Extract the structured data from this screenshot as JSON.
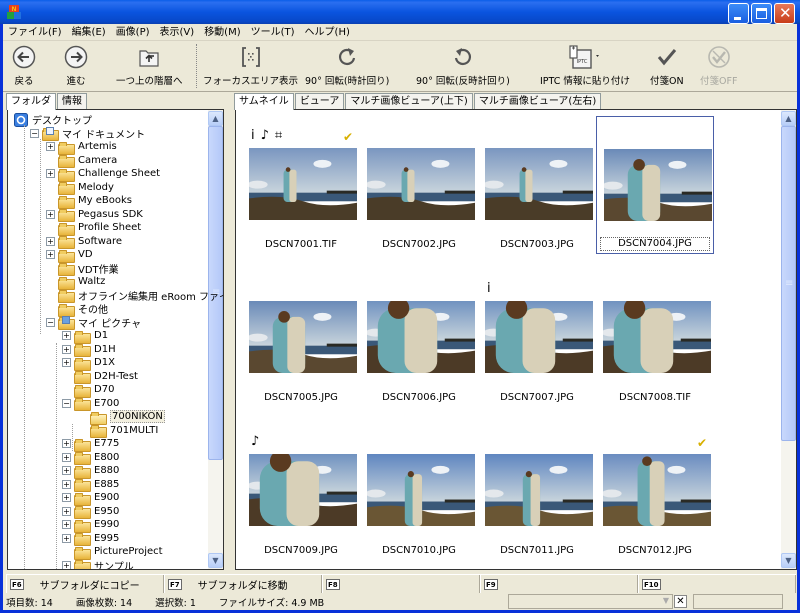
{
  "window": {
    "title": ""
  },
  "menu": [
    "ファイル(F)",
    "編集(E)",
    "画像(P)",
    "表示(V)",
    "移動(M)",
    "ツール(T)",
    "ヘルプ(H)"
  ],
  "toolbar": {
    "back": "戻る",
    "forward": "進む",
    "up": "一つ上の階層へ",
    "focus_area": "フォーカスエリア表示",
    "rotate_cw": "90° 回転(時計回り)",
    "rotate_ccw": "90° 回転(反時計回り)",
    "iptc_paste": "IPTC 情報に貼り付け",
    "tag_on": "付箋ON",
    "tag_off": "付箋OFF"
  },
  "left_tabs": [
    "フォルダ",
    "情報"
  ],
  "tree": [
    {
      "label": "デスクトップ",
      "level": 0,
      "exp": "",
      "icon": "desktop"
    },
    {
      "label": "マイ ドキュメント",
      "level": 1,
      "exp": "-",
      "icon": "mydocs"
    },
    {
      "label": "Artemis",
      "level": 2,
      "exp": "+"
    },
    {
      "label": "Camera",
      "level": 2,
      "exp": ""
    },
    {
      "label": "Challenge Sheet",
      "level": 2,
      "exp": "+"
    },
    {
      "label": "Melody",
      "level": 2,
      "exp": ""
    },
    {
      "label": "My eBooks",
      "level": 2,
      "exp": ""
    },
    {
      "label": "Pegasus SDK",
      "level": 2,
      "exp": "+"
    },
    {
      "label": "Profile Sheet",
      "level": 2,
      "exp": ""
    },
    {
      "label": "Software",
      "level": 2,
      "exp": "+"
    },
    {
      "label": "VD",
      "level": 2,
      "exp": "+"
    },
    {
      "label": "VDT作業",
      "level": 2,
      "exp": ""
    },
    {
      "label": "Waltz",
      "level": 2,
      "exp": ""
    },
    {
      "label": "オフライン編集用 eRoom ファイル",
      "level": 2,
      "exp": ""
    },
    {
      "label": "その他",
      "level": 2,
      "exp": ""
    },
    {
      "label": "マイ ピクチャ",
      "level": 2,
      "exp": "-",
      "icon": "mypics"
    },
    {
      "label": "D1",
      "level": 3,
      "exp": "+"
    },
    {
      "label": "D1H",
      "level": 3,
      "exp": "+"
    },
    {
      "label": "D1X",
      "level": 3,
      "exp": "+"
    },
    {
      "label": "D2H-Test",
      "level": 3,
      "exp": ""
    },
    {
      "label": "D70",
      "level": 3,
      "exp": ""
    },
    {
      "label": "E700",
      "level": 3,
      "exp": "-"
    },
    {
      "label": "700NIKON",
      "level": 4,
      "exp": "",
      "selected": true
    },
    {
      "label": "701MULTI",
      "level": 4,
      "exp": ""
    },
    {
      "label": "E775",
      "level": 3,
      "exp": "+"
    },
    {
      "label": "E800",
      "level": 3,
      "exp": "+"
    },
    {
      "label": "E880",
      "level": 3,
      "exp": "+"
    },
    {
      "label": "E885",
      "level": 3,
      "exp": "+"
    },
    {
      "label": "E900",
      "level": 3,
      "exp": "+"
    },
    {
      "label": "E950",
      "level": 3,
      "exp": "+"
    },
    {
      "label": "E990",
      "level": 3,
      "exp": "+"
    },
    {
      "label": "E995",
      "level": 3,
      "exp": "+"
    },
    {
      "label": "PictureProject",
      "level": 3,
      "exp": ""
    },
    {
      "label": "サンプル",
      "level": 3,
      "exp": "+"
    }
  ],
  "right_tabs": [
    "サムネイル",
    "ビューア",
    "マルチ画像ビューア(上下)",
    "マルチ画像ビューア(左右)"
  ],
  "thumbnails": [
    {
      "name": "DSCN7001.TIF",
      "icons": "i ♪ ⌗",
      "check": true,
      "scene": "far"
    },
    {
      "name": "DSCN7002.JPG",
      "icons": "",
      "check": false,
      "scene": "far"
    },
    {
      "name": "DSCN7003.JPG",
      "icons": "",
      "check": false,
      "scene": "far"
    },
    {
      "name": "DSCN7004.JPG",
      "icons": "",
      "check": false,
      "scene": "mid",
      "selected": true
    },
    {
      "name": "DSCN7005.JPG",
      "icons": "",
      "check": false,
      "scene": "mid"
    },
    {
      "name": "DSCN7006.JPG",
      "icons": "",
      "check": false,
      "scene": "close"
    },
    {
      "name": "DSCN7007.JPG",
      "icons": "i",
      "check": false,
      "scene": "close"
    },
    {
      "name": "DSCN7008.TIF",
      "icons": "",
      "check": false,
      "scene": "close"
    },
    {
      "name": "DSCN7009.JPG",
      "icons": "♪",
      "check": false,
      "scene": "close"
    },
    {
      "name": "DSCN7010.JPG",
      "icons": "",
      "check": false,
      "scene": "sit"
    },
    {
      "name": "DSCN7011.JPG",
      "icons": "",
      "check": false,
      "scene": "sit"
    },
    {
      "name": "DSCN7012.JPG",
      "icons": "",
      "check": true,
      "scene": "sitclose"
    }
  ],
  "fn_keys": [
    {
      "key": "F6",
      "label": "サブフォルダにコピー"
    },
    {
      "key": "F7",
      "label": "サブフォルダに移動"
    },
    {
      "key": "F8",
      "label": ""
    },
    {
      "key": "F9",
      "label": ""
    },
    {
      "key": "F10",
      "label": ""
    }
  ],
  "status": {
    "items": "項目数: 14",
    "images": "画像枚数: 14",
    "selected": "選択数: 1",
    "filesize": "ファイルサイズ: 4.9 MB",
    "close_glyph": "✕"
  },
  "colors": {
    "title_bar": "#0a54df",
    "selection_border": "#4a5fa8",
    "check": "#d8b000"
  }
}
